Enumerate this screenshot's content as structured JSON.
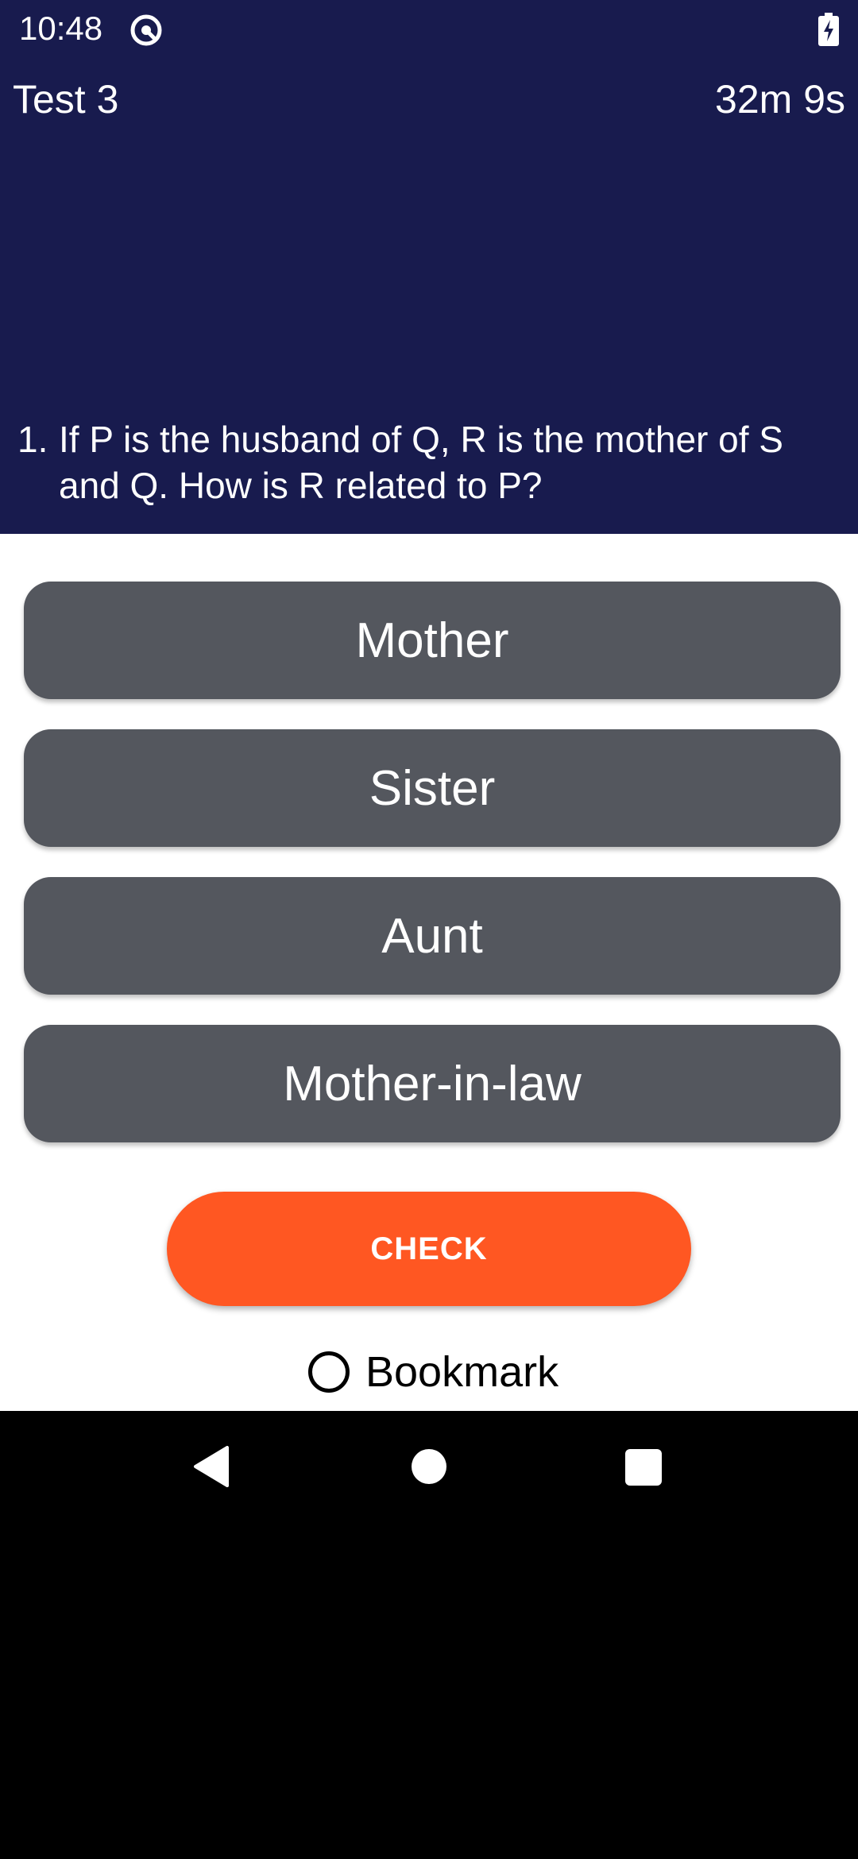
{
  "status_bar": {
    "time": "10:48"
  },
  "header": {
    "title": "Test 3",
    "timer": "32m 9s"
  },
  "question": {
    "number": "1.",
    "text": "If P is the husband of Q, R is the mother of S and Q. How is R related to P?"
  },
  "options": [
    "Mother",
    "Sister",
    "Aunt",
    "Mother-in-law"
  ],
  "actions": {
    "check_label": "CHECK",
    "bookmark_label": "Bookmark"
  },
  "colors": {
    "header_bg": "#181b4e",
    "option_bg": "#54575e",
    "accent": "#ff5722"
  },
  "icons": [
    "app-status-icon",
    "battery-charging-icon",
    "radio-unchecked-icon",
    "nav-back-icon",
    "nav-home-icon",
    "nav-recents-icon"
  ]
}
